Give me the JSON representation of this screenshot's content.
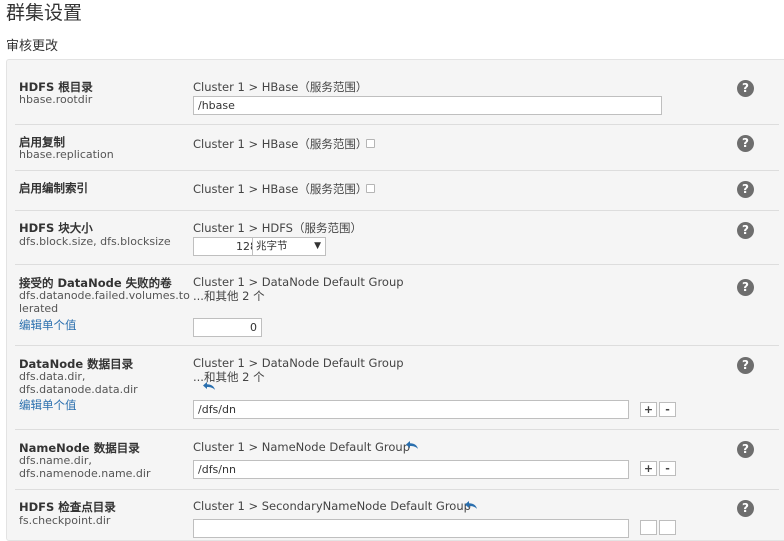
{
  "page": {
    "title": "群集设置",
    "subtitle": "审核更改"
  },
  "icons": {
    "help": "help-circle-icon",
    "revert": "revert-arrow-icon",
    "checkbox": "checkbox-icon"
  },
  "colors": {
    "panel_bg": "#f5f5f5",
    "link": "#2a6fae",
    "help_icon": "#6e6e6e"
  },
  "rows": [
    {
      "label": "HDFS 根目录",
      "keys": [
        "hbase.rootdir"
      ],
      "scope": "Cluster 1 > HBase（服务范围）",
      "value": "/hbase"
    },
    {
      "label": "启用复制",
      "keys": [
        "hbase.replication"
      ],
      "scope": "Cluster 1 > HBase（服务范围）",
      "checked": false
    },
    {
      "label": "启用编制索引",
      "keys": [],
      "scope": "Cluster 1 > HBase（服务范围）",
      "checked": false
    },
    {
      "label": "HDFS 块大小",
      "keys": [
        "dfs.block.size, dfs.blocksize"
      ],
      "scope": "Cluster 1 > HDFS（服务范围）",
      "value": "128",
      "unit": "兆字节"
    },
    {
      "label": "接受的 DataNode 失败的卷",
      "keys": [
        "dfs.datanode.failed.volumes.to",
        "lerated"
      ],
      "scope": "Cluster 1 > DataNode Default Group",
      "more": "...和其他 2 个",
      "edit": "编辑单个值",
      "value": "0"
    },
    {
      "label": "DataNode 数据目录",
      "keys": [
        "dfs.data.dir,",
        "dfs.datanode.data.dir"
      ],
      "scope": "Cluster 1 > DataNode Default Group",
      "more": "...和其他 2 个",
      "edit": "编辑单个值",
      "value": "/dfs/dn"
    },
    {
      "label": "NameNode 数据目录",
      "keys": [
        "dfs.name.dir,",
        "dfs.namenode.name.dir"
      ],
      "scope": "Cluster 1 > NameNode Default Group",
      "value": "/dfs/nn"
    },
    {
      "label": "HDFS 检查点目录",
      "keys": [
        "fs.checkpoint.dir"
      ],
      "scope": "Cluster 1 > SecondaryNameNode Default Group"
    }
  ],
  "buttons": {
    "plus": "+",
    "minus": "-",
    "help": "?"
  }
}
